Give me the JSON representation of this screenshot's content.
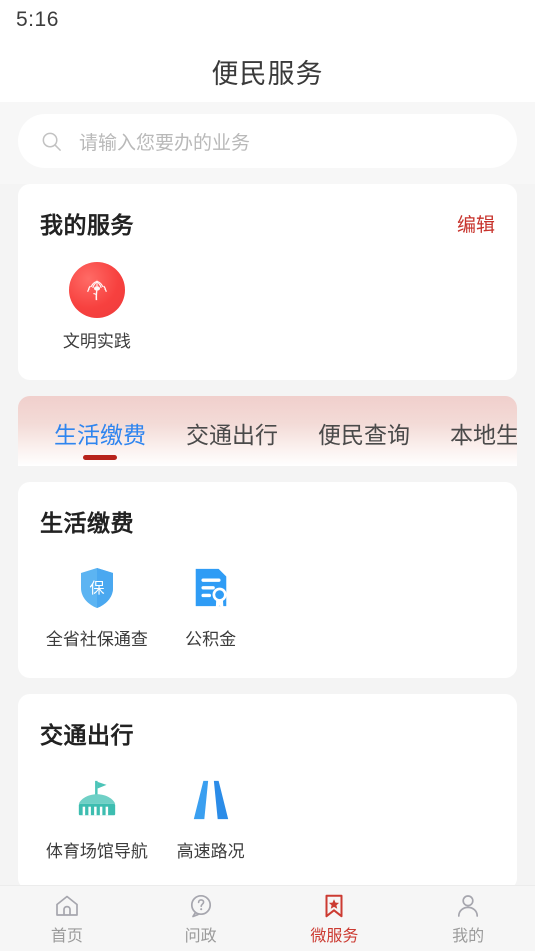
{
  "status_bar": {
    "time": "5:16"
  },
  "header": {
    "title": "便民服务"
  },
  "search": {
    "placeholder": "请输入您要办的业务",
    "icon": "search-icon",
    "value": ""
  },
  "my_services": {
    "title": "我的服务",
    "action_label": "编辑",
    "action_color": "#c7322b",
    "items": [
      {
        "label": "文明实践",
        "icon": "palm-tree-circle-icon",
        "color": "#f2413f"
      }
    ]
  },
  "tabs": {
    "items": [
      {
        "label": "生活缴费",
        "active": true
      },
      {
        "label": "交通出行",
        "active": false
      },
      {
        "label": "便民查询",
        "active": false
      },
      {
        "label": "本地生活",
        "active": false
      }
    ],
    "active_color": "#2f85ef",
    "indicator_color": "#b8231c",
    "background_color": "#f0cfcc"
  },
  "sections": [
    {
      "title": "生活缴费",
      "items": [
        {
          "label": "全省社保通查",
          "icon": "shield-insurance-icon",
          "color": "#4aa8f0"
        },
        {
          "label": "公积金",
          "icon": "document-award-icon",
          "color": "#2f9cf5"
        }
      ]
    },
    {
      "title": "交通出行",
      "items": [
        {
          "label": "体育场馆导航",
          "icon": "stadium-flag-icon",
          "color": "#4cc4b8"
        },
        {
          "label": "高速路况",
          "icon": "highway-road-icon",
          "color": "#2b8ce8"
        }
      ]
    }
  ],
  "bottom_nav": {
    "items": [
      {
        "label": "首页",
        "icon": "home-icon",
        "active": false
      },
      {
        "label": "问政",
        "icon": "question-bubble-icon",
        "active": false
      },
      {
        "label": "微服务",
        "icon": "bookmark-star-icon",
        "active": true
      },
      {
        "label": "我的",
        "icon": "person-icon",
        "active": false
      }
    ],
    "active_color": "#cc3b32",
    "inactive_color": "#9b9b9b"
  }
}
